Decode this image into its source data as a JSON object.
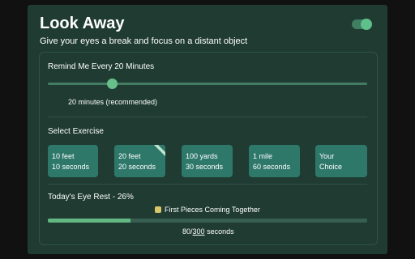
{
  "header": {
    "title": "Look Away",
    "subtitle": "Give your eyes a break and focus on a distant object",
    "toggle_enabled": true
  },
  "reminder": {
    "label": "Remind Me Every 20 Minutes",
    "slider_fraction": 0.2,
    "caption": "20 minutes (recommended)"
  },
  "exercise": {
    "label": "Select Exercise",
    "options": [
      {
        "line1": "10 feet",
        "line2": "10 seconds"
      },
      {
        "line1": "20 feet",
        "line2": "20 seconds",
        "selected": true
      },
      {
        "line1": "100 yards",
        "line2": "30 seconds"
      },
      {
        "line1": "1 mile",
        "line2": "60 seconds"
      },
      {
        "line1": "Your",
        "line2": "Choice"
      }
    ]
  },
  "eye_rest": {
    "label": "Today's Eye Rest - 26%",
    "progress_percent": 26,
    "badge_icon": "puzzle-piece-icon",
    "badge_text": "First Pieces Coming Together",
    "current_seconds": "80",
    "total_seconds": "300",
    "seconds_unit": " seconds"
  },
  "colors": {
    "accent": "#63b783",
    "panel": "#1f3b32",
    "button": "#2e786a"
  }
}
